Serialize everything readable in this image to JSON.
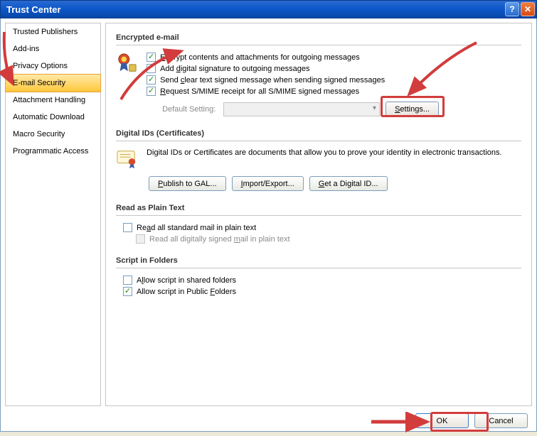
{
  "window": {
    "title": "Trust Center"
  },
  "sidebar": {
    "items": [
      {
        "label": "Trusted Publishers"
      },
      {
        "label": "Add-ins"
      },
      {
        "label": "Privacy Options"
      },
      {
        "label": "E-mail Security"
      },
      {
        "label": "Attachment Handling"
      },
      {
        "label": "Automatic Download"
      },
      {
        "label": "Macro Security"
      },
      {
        "label": "Programmatic Access"
      }
    ],
    "active_index": 3
  },
  "sections": {
    "encrypted": {
      "title": "Encrypted e-mail",
      "encrypt": {
        "label_pre": "",
        "label_u": "E",
        "label_post": "ncrypt contents and attachments for outgoing messages",
        "checked": true
      },
      "sign": {
        "label": "Add ",
        "label_u": "d",
        "label_post": "igital signature to outgoing messages",
        "checked": false
      },
      "cleartext": {
        "label": "Send ",
        "label_u": "c",
        "label_post": "lear text signed message when sending signed messages",
        "checked": true
      },
      "receipt": {
        "label_pre": "",
        "label_u": "R",
        "label_post": "equest S/MIME receipt for all S/MIME signed messages",
        "checked": true
      },
      "default_label": "Default Setting:",
      "settings_btn_pre": "",
      "settings_btn_u": "S",
      "settings_btn_post": "ettings..."
    },
    "digital_ids": {
      "title": "Digital IDs (Certificates)",
      "desc": "Digital IDs or Certificates are documents that allow you to prove your identity in electronic transactions.",
      "publish_pre": "",
      "publish_u": "P",
      "publish_post": "ublish to GAL...",
      "import_pre": "",
      "import_u": "I",
      "import_post": "mport/Export...",
      "get_pre": "",
      "get_u": "G",
      "get_post": "et a Digital ID..."
    },
    "plain_text": {
      "title": "Read as Plain Text",
      "read_all": {
        "label": "Re",
        "label_u": "a",
        "label_post": "d all standard mail in plain text",
        "checked": false
      },
      "read_signed": {
        "label": "Read all digitally signed ",
        "label_u": "m",
        "label_post": "ail in plain text",
        "checked": false,
        "disabled": true
      }
    },
    "script": {
      "title": "Script in Folders",
      "shared": {
        "label": "A",
        "label_u": "l",
        "label_post": "low script in shared folders",
        "checked": false
      },
      "public": {
        "label": "Allow script in Public ",
        "label_u": "F",
        "label_post": "olders",
        "checked": true
      }
    }
  },
  "footer": {
    "ok": "OK",
    "cancel": "Cancel"
  }
}
